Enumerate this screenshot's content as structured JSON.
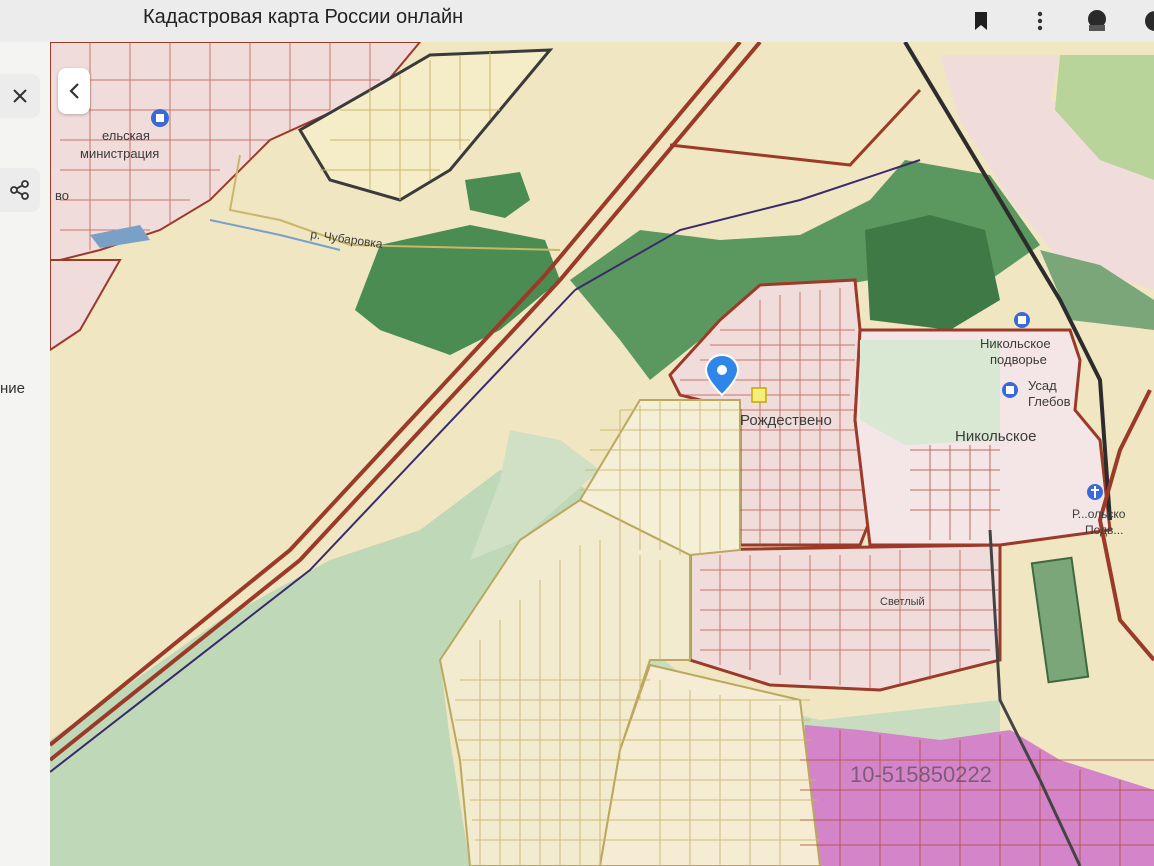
{
  "header": {
    "title": "Кадастровая карта России онлайн",
    "bookmark_icon": "bookmark-icon",
    "menu_icon": "more-vert-icon",
    "extension_icon": "extension-icon"
  },
  "sidebar": {
    "close_icon": "close-icon",
    "share_icon": "share-icon",
    "collapse_icon": "chevron-left-icon",
    "partial_text": "ние"
  },
  "map": {
    "labels": {
      "administration_1": "ельская",
      "administration_2": "министрация",
      "river": "р. Чубаровка",
      "partial_left": "во",
      "village": "Рождествено",
      "nikolskoe": "Никольское",
      "podvorye_1": "Никольское",
      "podvorye_2": "подворье",
      "usadba_1": "Усад",
      "usadba_2": "Глебов",
      "podvorye_right_1": "Р...ольско",
      "podvorye_right_2": "Подв...",
      "settlement": "Светлый",
      "watermark": "10-515850222"
    },
    "colors": {
      "yellow_area": "#f0e6c2",
      "light_green": "#bfd8b8",
      "forest": "#4a8c52",
      "pink_area": "#f1dcdc",
      "magenta_area": "#d484c9",
      "border": "#9c3a2a",
      "marker": "#2f86e8"
    },
    "marker_icon": "location-pin-icon",
    "map_icons": [
      "building-icon",
      "building-icon",
      "church-icon"
    ]
  }
}
